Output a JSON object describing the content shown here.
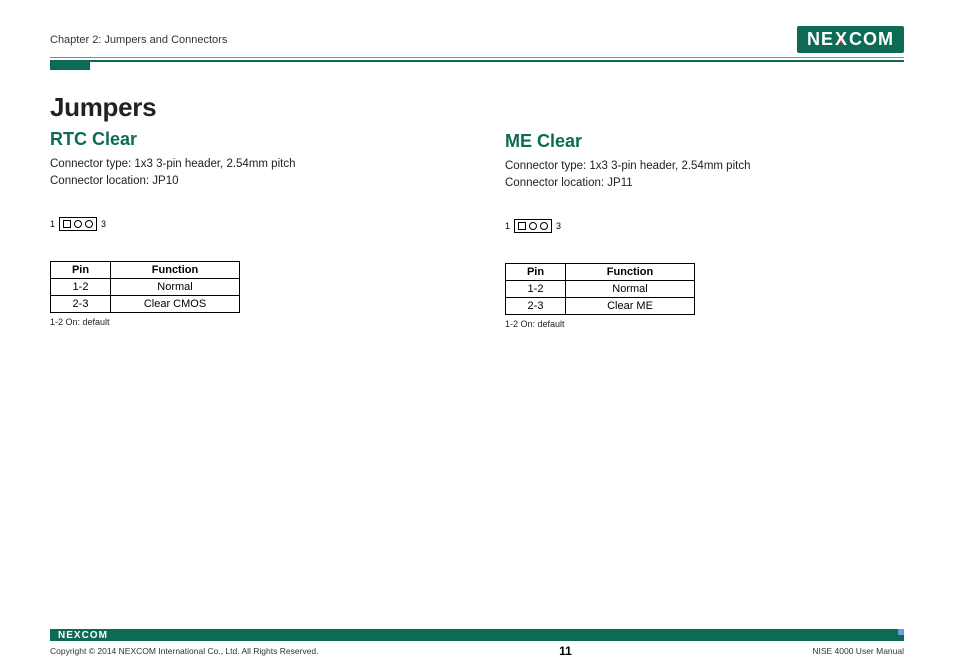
{
  "header": {
    "chapter": "Chapter 2: Jumpers and Connectors",
    "brand": "NEXCOM"
  },
  "page": {
    "title": "Jumpers",
    "sections": [
      {
        "title": "RTC Clear",
        "connector_type": "Connector type: 1x3 3-pin header, 2.54mm pitch",
        "connector_location": "Connector location: JP10",
        "diagram": {
          "left_label": "1",
          "right_label": "3"
        },
        "table": {
          "headers": [
            "Pin",
            "Function"
          ],
          "rows": [
            [
              "1-2",
              "Normal"
            ],
            [
              "2-3",
              "Clear CMOS"
            ]
          ],
          "note": "1-2 On: default"
        }
      },
      {
        "title": "ME Clear",
        "connector_type": "Connector type: 1x3 3-pin header, 2.54mm pitch",
        "connector_location": "Connector location: JP11",
        "diagram": {
          "left_label": "1",
          "right_label": "3"
        },
        "table": {
          "headers": [
            "Pin",
            "Function"
          ],
          "rows": [
            [
              "1-2",
              "Normal"
            ],
            [
              "2-3",
              "Clear ME"
            ]
          ],
          "note": "1-2 On: default"
        }
      }
    ]
  },
  "footer": {
    "brand": "NEXCOM",
    "copyright": "Copyright © 2014 NEXCOM International Co., Ltd. All Rights Reserved.",
    "page_number": "11",
    "manual": "NISE 4000 User Manual"
  }
}
